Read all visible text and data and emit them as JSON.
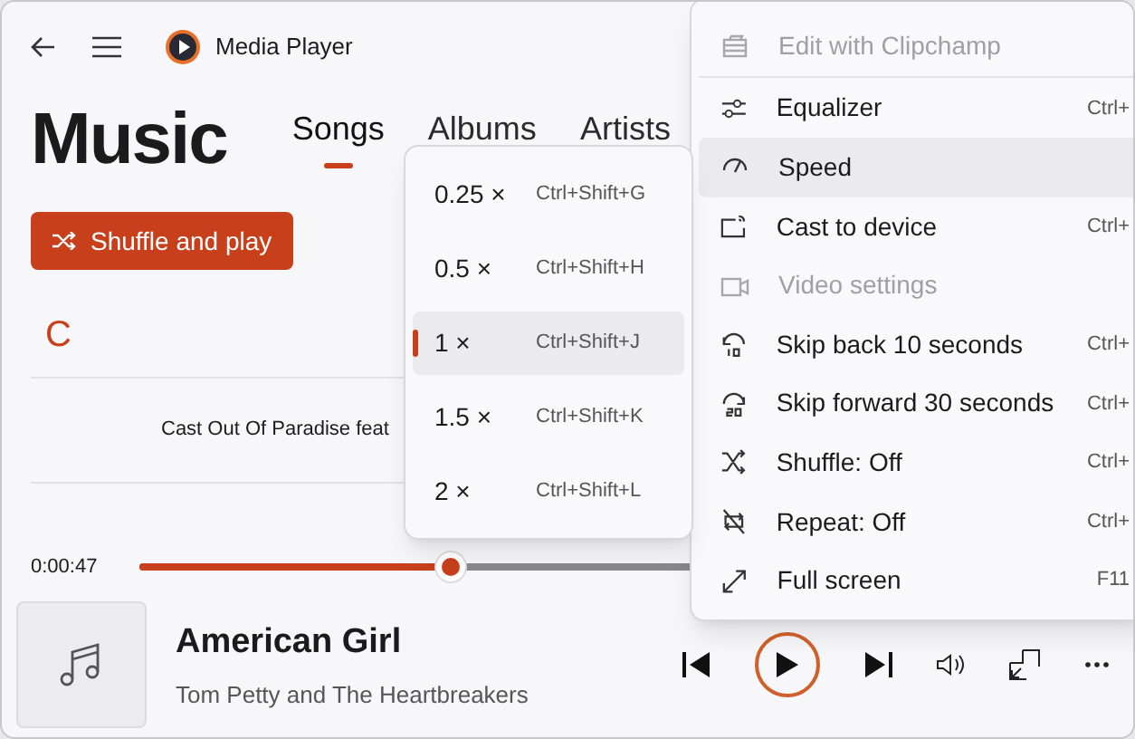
{
  "app": {
    "title": "Media Player"
  },
  "header": {
    "title": "Music"
  },
  "tabs": [
    {
      "label": "Songs",
      "selected": true
    },
    {
      "label": "Albums",
      "selected": false
    },
    {
      "label": "Artists",
      "selected": false
    }
  ],
  "shuffle_button": {
    "label": "Shuffle and play"
  },
  "song_list": {
    "group_letter": "C",
    "rows": [
      {
        "title": "Cast Out Of Paradise feat"
      }
    ]
  },
  "player": {
    "elapsed": "0:00:47",
    "level": 0.33,
    "track_title": "American Girl",
    "artist": "Tom Petty and The Heartbreakers"
  },
  "context_menu": {
    "items": [
      {
        "label": "Edit with Clipchamp",
        "disabled": true,
        "highlighted": false
      },
      {
        "label": "Equalizer",
        "shortcut": "Ctrl+",
        "disabled": false,
        "highlighted": false
      },
      {
        "label": "Speed",
        "disabled": false,
        "highlighted": true
      },
      {
        "label": "Cast to device",
        "shortcut": "Ctrl+",
        "disabled": false,
        "highlighted": false
      },
      {
        "label": "Video settings",
        "disabled": true,
        "highlighted": false
      },
      {
        "label": "Skip back 10 seconds",
        "shortcut": "Ctrl+",
        "disabled": false,
        "highlighted": false
      },
      {
        "label": "Skip forward 30 seconds",
        "shortcut": "Ctrl+",
        "disabled": false,
        "highlighted": false
      },
      {
        "label": "Shuffle: Off",
        "shortcut": "Ctrl+",
        "disabled": false,
        "highlighted": false
      },
      {
        "label": "Repeat: Off",
        "shortcut": "Ctrl+",
        "disabled": false,
        "highlighted": false
      },
      {
        "label": "Full screen",
        "shortcut": "F11",
        "disabled": false,
        "highlighted": false
      }
    ]
  },
  "speed_menu": {
    "items": [
      {
        "label": "0.25 ×",
        "shortcut": "Ctrl+Shift+G",
        "selected": false
      },
      {
        "label": "0.5 ×",
        "shortcut": "Ctrl+Shift+H",
        "selected": false
      },
      {
        "label": "1 ×",
        "shortcut": "Ctrl+Shift+J",
        "selected": true
      },
      {
        "label": "1.5 ×",
        "shortcut": "Ctrl+Shift+K",
        "selected": false
      },
      {
        "label": "2 ×",
        "shortcut": "Ctrl+Shift+L",
        "selected": false
      }
    ]
  }
}
